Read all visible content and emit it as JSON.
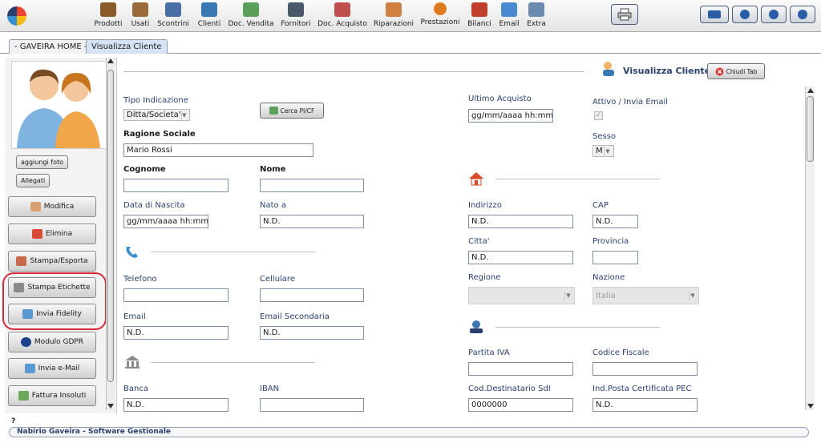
{
  "toolbar": {
    "items": [
      {
        "label": "Prodotti",
        "icon": "products-icon",
        "color": "#8a5a2b"
      },
      {
        "label": "Usati",
        "icon": "used-items-icon",
        "color": "#9a6b3a"
      },
      {
        "label": "Scontrini",
        "icon": "receipts-icon",
        "color": "#4a6fa5"
      },
      {
        "label": "Clienti",
        "icon": "clients-icon",
        "color": "#3a77b5"
      },
      {
        "label": "Doc. Vendita",
        "icon": "sales-doc-icon",
        "color": "#5aa05a"
      },
      {
        "label": "Fornitori",
        "icon": "suppliers-icon",
        "color": "#4a5a6a"
      },
      {
        "label": "Doc. Acquisto",
        "icon": "purchase-doc-icon",
        "color": "#c0504d"
      },
      {
        "label": "Riparazioni",
        "icon": "repairs-icon",
        "color": "#d08040"
      },
      {
        "label": "Prestazioni",
        "icon": "services-icon",
        "color": "#e07a1f"
      },
      {
        "label": "Bilanci",
        "icon": "balances-icon",
        "color": "#c04030"
      },
      {
        "label": "Email",
        "icon": "email-icon",
        "color": "#4a8ad0"
      },
      {
        "label": "Extra",
        "icon": "extra-tools-icon",
        "color": "#6a8ab0"
      }
    ],
    "right_buttons": [
      {
        "icon": "printer-icon"
      },
      {
        "icon": "keyboard-icon"
      },
      {
        "icon": "settings-gear-icon"
      },
      {
        "icon": "minimize-icon"
      },
      {
        "icon": "power-icon"
      }
    ]
  },
  "tabs": [
    {
      "label": "- GAVEIRA HOME -"
    },
    {
      "label": "Visualizza Cliente"
    }
  ],
  "left_panel": {
    "add_photo": "aggiungi foto",
    "attachments": "Allegati",
    "buttons": [
      {
        "label": "Modifica",
        "icon": "edit-icon"
      },
      {
        "label": "Elimina",
        "icon": "delete-icon"
      },
      {
        "label": "Stampa/Esporta",
        "icon": "print-export-icon"
      },
      {
        "label": "Stampa Etichette",
        "icon": "label-printer-icon"
      },
      {
        "label": "Invia Fidelity",
        "icon": "fidelity-card-icon"
      },
      {
        "label": "Modulo GDPR",
        "icon": "gdpr-icon"
      },
      {
        "label": "Invia e-Mail",
        "icon": "send-email-icon"
      },
      {
        "label": "Fattura Insoluti",
        "icon": "unpaid-invoice-icon"
      }
    ]
  },
  "form": {
    "title": "Visualizza Cliente",
    "close_tab": "Chiudi Tab",
    "search_vat": "Cerca PI/CF",
    "tipo_indicazione": {
      "label": "Tipo Indicazione",
      "value": "Ditta/Societa'"
    },
    "ragione_sociale": {
      "label": "Ragione Sociale",
      "value": "Mario Rossi"
    },
    "cognome": {
      "label": "Cognome",
      "value": ""
    },
    "nome": {
      "label": "Nome",
      "value": ""
    },
    "data_nascita": {
      "label": "Data di Nascita",
      "value": "gg/mm/aaaa hh:mm"
    },
    "nato_a": {
      "label": "Nato a",
      "value": "N.D."
    },
    "telefono": {
      "label": "Telefono",
      "value": ""
    },
    "cellulare": {
      "label": "Cellulare",
      "value": ""
    },
    "email": {
      "label": "Email",
      "value": "N.D."
    },
    "email_secondaria": {
      "label": "Email Secondaria",
      "value": "N.D."
    },
    "banca": {
      "label": "Banca",
      "value": "N.D."
    },
    "iban": {
      "label": "IBAN",
      "value": ""
    },
    "ultimo_acquisto": {
      "label": "Ultimo Acquisto",
      "value": "gg/mm/aaaa hh:mm"
    },
    "attivo": {
      "label": "Attivo / Invia Email",
      "checked": true
    },
    "sesso": {
      "label": "Sesso",
      "value": "M"
    },
    "indirizzo": {
      "label": "Indirizzo",
      "value": "N.D."
    },
    "cap": {
      "label": "CAP",
      "value": "N.D."
    },
    "citta": {
      "label": "Citta'",
      "value": "N.D."
    },
    "provincia": {
      "label": "Provincia",
      "value": ""
    },
    "regione": {
      "label": "Regione",
      "value": ""
    },
    "nazione": {
      "label": "Nazione",
      "value": "Italia"
    },
    "partita_iva": {
      "label": "Partita IVA",
      "value": ""
    },
    "codice_fiscale": {
      "label": "Codice Fiscale",
      "value": ""
    },
    "cod_destinatario": {
      "label": "Cod.Destinatario SdI",
      "value": "0000000"
    },
    "pec": {
      "label": "Ind.Posta Certificata PEC",
      "value": "N.D."
    }
  },
  "status_bar": {
    "help": "?",
    "app_name": "Nabirio Gaveira - Software Gestionale"
  },
  "colors": {
    "highlight": "#d42a3a",
    "label_text": "#2a3f6e"
  }
}
